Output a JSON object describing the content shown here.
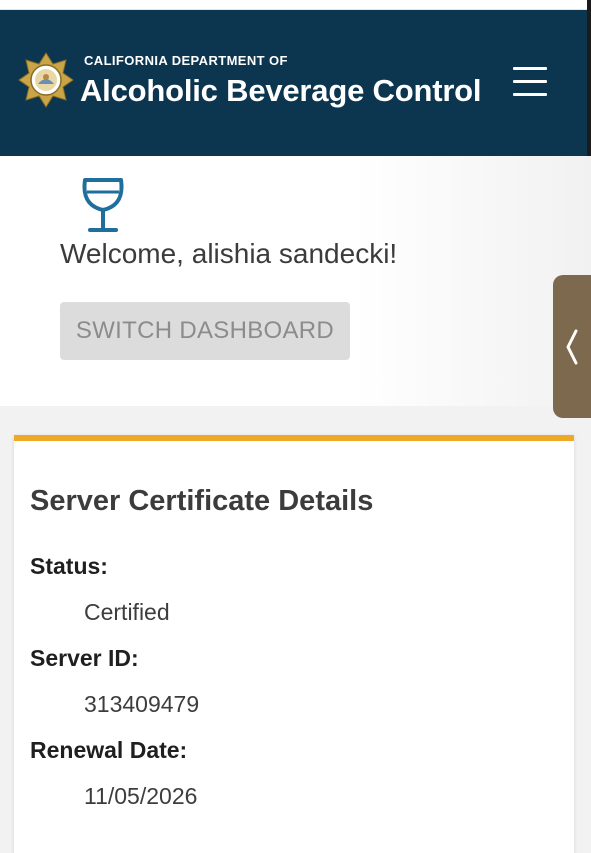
{
  "header": {
    "org_small": "CALIFORNIA DEPARTMENT OF",
    "org_large": "Alcoholic Beverage Control",
    "seal_icon": "california-seal-icon",
    "menu_icon": "hamburger-menu-icon",
    "background_color": "#0c3550"
  },
  "welcome": {
    "icon": "wine-glass-icon",
    "message": "Welcome, alishia sandecki!",
    "switch_button_label": "SWITCH DASHBOARD"
  },
  "drawer": {
    "icon": "chevron-left-icon",
    "color": "#7d6a4e"
  },
  "certificate": {
    "title": "Server Certificate Details",
    "accent_color": "#f0a827",
    "fields": [
      {
        "label": "Status:",
        "value": "Certified"
      },
      {
        "label": "Server ID:",
        "value": "313409479"
      },
      {
        "label": "Renewal Date:",
        "value": "11/05/2026"
      }
    ]
  }
}
